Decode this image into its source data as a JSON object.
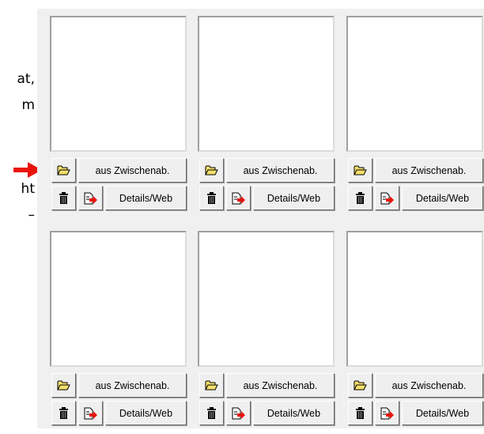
{
  "side_text": [
    "at,",
    "m",
    "ht",
    "–"
  ],
  "marker": {
    "icon": "red-arrow-icon",
    "color": "#e8140c"
  },
  "slots": [
    {
      "paste_label": "aus Zwischenab.",
      "details_label": "Details/Web"
    },
    {
      "paste_label": "aus Zwischenab.",
      "details_label": "Details/Web"
    },
    {
      "paste_label": "aus Zwischenab.",
      "details_label": "Details/Web"
    },
    {
      "paste_label": "aus Zwischenab.",
      "details_label": "Details/Web"
    },
    {
      "paste_label": "aus Zwischenab.",
      "details_label": "Details/Web"
    },
    {
      "paste_label": "aus Zwischenab.",
      "details_label": "Details/Web"
    }
  ],
  "icons": {
    "open": "folder-open-icon",
    "delete": "trash-icon",
    "export": "export-arrow-icon"
  },
  "colors": {
    "panel": "#f0f0f0",
    "folder": "#f5e06b",
    "arrow": "#e8140c"
  }
}
